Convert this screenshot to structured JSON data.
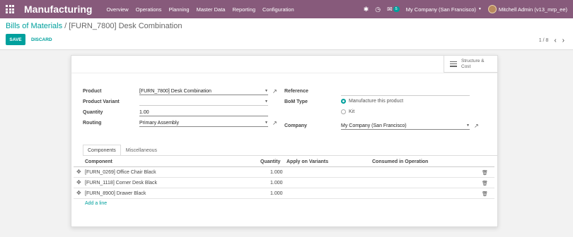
{
  "navbar": {
    "app_name": "Manufacturing",
    "menu": [
      "Overview",
      "Operations",
      "Planning",
      "Master Data",
      "Reporting",
      "Configuration"
    ],
    "chat_count": "5",
    "company": "My Company (San Francisco)",
    "user": "Mitchell Admin (v13_mrp_ee)"
  },
  "breadcrumb": {
    "parent": "Bills of Materials",
    "separator": "/",
    "current": "[FURN_7800] Desk Combination"
  },
  "buttons": {
    "save": "SAVE",
    "discard": "DISCARD"
  },
  "pager": {
    "value": "1 / 8",
    "prev": "‹",
    "next": "›"
  },
  "smart_button": {
    "line1": "Structure &",
    "line2": "Cost"
  },
  "form": {
    "product_label": "Product",
    "product_value": "[FURN_7800] Desk Combination",
    "variant_label": "Product Variant",
    "variant_value": "",
    "quantity_label": "Quantity",
    "quantity_value": "1.00",
    "routing_label": "Routing",
    "routing_value": "Primary Assembly",
    "reference_label": "Reference",
    "reference_value": "",
    "bom_type_label": "BoM Type",
    "bom_type_options": [
      "Manufacture this product",
      "Kit"
    ],
    "bom_type_selected": 0,
    "company_label": "Company",
    "company_value": "My Company (San Francisco)"
  },
  "tabs": [
    "Components",
    "Miscellaneous"
  ],
  "components_table": {
    "headers": [
      "Component",
      "Quantity",
      "Apply on Variants",
      "Consumed in Operation"
    ],
    "rows": [
      {
        "component": "[FURN_0269] Office Chair Black",
        "quantity": "1.000"
      },
      {
        "component": "[FURN_1118] Corner Desk Black",
        "quantity": "1.000"
      },
      {
        "component": "[FURN_8900] Drawer Black",
        "quantity": "1.000"
      }
    ],
    "add_line": "Add a line"
  },
  "icons": {
    "apps": "grid-icon",
    "bug": "bug-icon",
    "clock": "clock-icon",
    "chat": "chat-icon",
    "external_link": "external-link-icon",
    "structure": "bars-icon",
    "drag_handle": "drag-handle-icon",
    "trash": "trash-icon"
  },
  "colors": {
    "navbar": "#875a7b",
    "accent": "#00a09d"
  }
}
